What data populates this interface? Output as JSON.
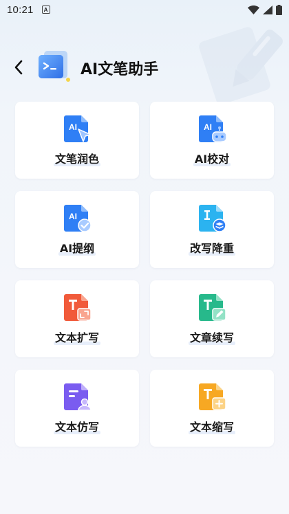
{
  "status_bar": {
    "time": "10:21",
    "notification_icon": "a-notification-icon",
    "icons": [
      "wifi-icon",
      "signal-icon",
      "battery-icon"
    ]
  },
  "header": {
    "title": "AI文笔助手",
    "back_icon": "chevron-left-icon",
    "logo_icon": "ai-document-logo-icon"
  },
  "colors": {
    "blue": "#2f7ff5",
    "red": "#f15a3a",
    "green": "#27b98b",
    "purple": "#7a5cf0",
    "orange": "#f7a823",
    "background": "#f3f6fa",
    "card": "#ffffff"
  },
  "tools": [
    {
      "label": "文笔润色",
      "icon": "ai-doc-cursor-icon"
    },
    {
      "label": "AI校对",
      "icon": "ai-doc-robot-icon"
    },
    {
      "label": "AI提纲",
      "icon": "ai-doc-check-icon"
    },
    {
      "label": "改写降重",
      "icon": "doc-layers-icon"
    },
    {
      "label": "文本扩写",
      "icon": "text-expand-icon"
    },
    {
      "label": "文章续写",
      "icon": "text-continue-pen-icon"
    },
    {
      "label": "文本仿写",
      "icon": "text-imitate-user-icon"
    },
    {
      "label": "文本缩写",
      "icon": "text-abbreviate-plus-icon"
    }
  ]
}
